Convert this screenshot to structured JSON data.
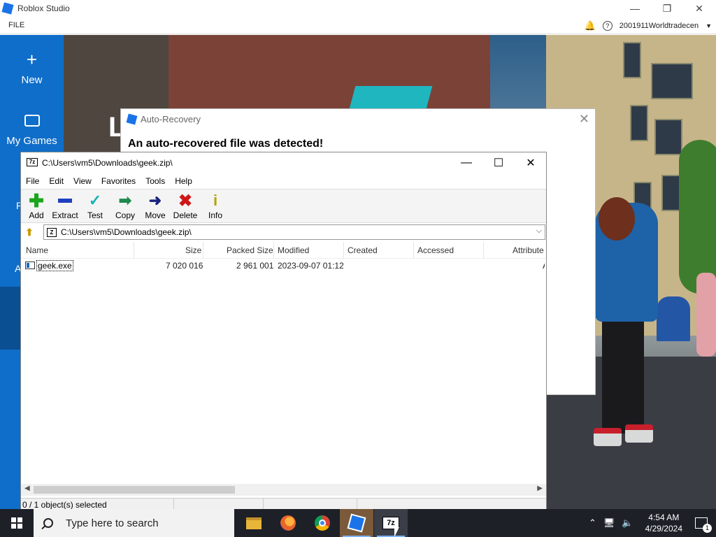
{
  "roblox": {
    "title": "Roblox Studio",
    "menu_file": "FILE",
    "username": "2001911Worldtradecen",
    "sidebar": {
      "new_label": "New",
      "new_icon": "plus-icon",
      "mygames_label": "My Games",
      "mygames_icon": "briefcase-icon"
    }
  },
  "auto_recovery": {
    "title": "Auto-Recovery",
    "heading": "An auto-recovered file was detected!"
  },
  "zip": {
    "title": "C:\\Users\\vm5\\Downloads\\geek.zip\\",
    "menu": [
      "File",
      "Edit",
      "View",
      "Favorites",
      "Tools",
      "Help"
    ],
    "toolbar": [
      {
        "label": "Add",
        "icon": "plus-icon",
        "color": "#1aa51a"
      },
      {
        "label": "Extract",
        "icon": "minus-icon",
        "color": "#1f3fbf"
      },
      {
        "label": "Test",
        "icon": "check-icon",
        "color": "#19b3b3"
      },
      {
        "label": "Copy",
        "icon": "double-arrow-icon",
        "color": "#1e8a4d"
      },
      {
        "label": "Move",
        "icon": "arrow-right-icon",
        "color": "#1a237e"
      },
      {
        "label": "Delete",
        "icon": "x-icon",
        "color": "#d01616"
      },
      {
        "label": "Info",
        "icon": "info-icon",
        "color": "#b3a400"
      }
    ],
    "address": "C:\\Users\\vm5\\Downloads\\geek.zip\\",
    "columns": [
      "Name",
      "Size",
      "Packed Size",
      "Modified",
      "Created",
      "Accessed",
      "Attribute"
    ],
    "rows": [
      {
        "name": "geek.exe",
        "size": "7 020 016",
        "packed": "2 961 001",
        "modified": "2023-09-07 01:12",
        "created": "",
        "accessed": "",
        "attr": "A"
      }
    ],
    "status": "0 / 1 object(s) selected"
  },
  "taskbar": {
    "search_placeholder": "Type here to search",
    "time": "4:54 AM",
    "date": "4/29/2024",
    "notifications": "1"
  }
}
